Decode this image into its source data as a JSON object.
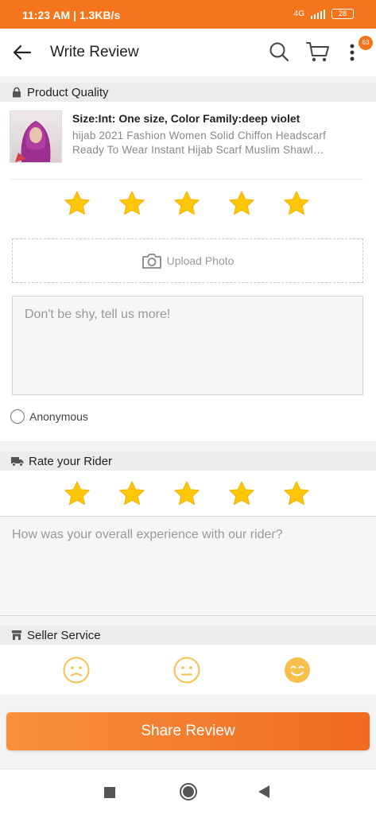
{
  "status_bar": {
    "time_speed": "11:23 AM | 1.3KB/s",
    "network": "4G",
    "battery": "28"
  },
  "header": {
    "title": "Write Review",
    "cart_badge": "63"
  },
  "product_quality": {
    "heading": "Product Quality",
    "variant": "Size:Int: One size, Color Family:deep violet",
    "name": "hijab 2021 Fashion Women Solid Chiffon Headscarf Ready To Wear Instant Hijab Scarf Muslim Shawl…",
    "rating": 5,
    "upload_label": "Upload Photo",
    "review_placeholder": "Don't be shy, tell us more!",
    "anonymous_label": "Anonymous"
  },
  "rider": {
    "heading": "Rate your Rider",
    "rating": 5,
    "placeholder": "How was your overall experience with our rider?"
  },
  "seller": {
    "heading": "Seller Service",
    "selected": "happy"
  },
  "share_button": "Share Review",
  "colors": {
    "brand": "#f4751b",
    "star": "#ffc60a",
    "face": "#f7c04a"
  }
}
